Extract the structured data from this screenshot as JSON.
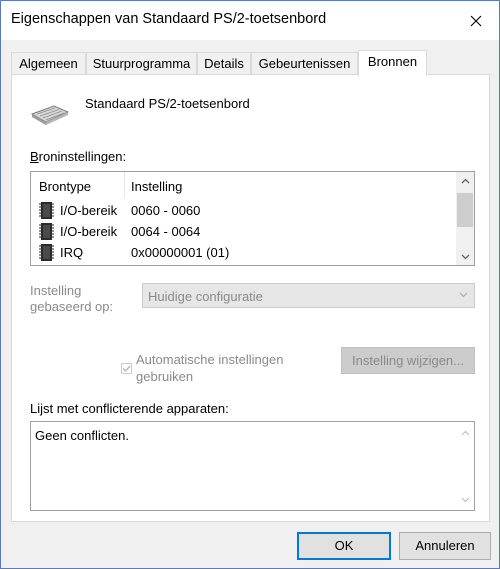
{
  "window": {
    "title": "Eigenschappen van Standaard PS/2-toetsenbord",
    "close_glyph": "✕"
  },
  "tabs": [
    {
      "label": "Algemeen",
      "active": false
    },
    {
      "label": "Stuurprogramma",
      "active": false
    },
    {
      "label": "Details",
      "active": false
    },
    {
      "label": "Gebeurtenissen",
      "active": false
    },
    {
      "label": "Bronnen",
      "active": true
    }
  ],
  "device": {
    "name": "Standaard PS/2-toetsenbord",
    "icon": "keyboard-icon"
  },
  "resources": {
    "label": "Broninstellingen:",
    "columns": [
      "Brontype",
      "Instelling"
    ],
    "rows": [
      {
        "type": "I/O-bereik",
        "value": "0060 - 0060",
        "icon": "chip-icon"
      },
      {
        "type": "I/O-bereik",
        "value": "0064 - 0064",
        "icon": "chip-icon"
      },
      {
        "type": "IRQ",
        "value": "0x00000001 (01)",
        "icon": "chip-icon"
      }
    ]
  },
  "setting_based": {
    "label_line1": "Instelling",
    "label_line2": "gebaseerd op:",
    "value": "Huidige configuratie"
  },
  "auto_settings": {
    "label_line1": "Automatische instellingen",
    "label_line2": "gebruiken",
    "checked": true,
    "enabled": false
  },
  "change_button": "Instelling wijzigen...",
  "conflicts": {
    "label": "Lijst met conflicterende apparaten:",
    "text": "Geen conflicten."
  },
  "buttons": {
    "ok": "OK",
    "cancel": "Annuleren"
  },
  "colors": {
    "accent": "#0078d7",
    "disabled_text": "#8a8a8a",
    "dialog_bg": "#f0f0f0"
  }
}
